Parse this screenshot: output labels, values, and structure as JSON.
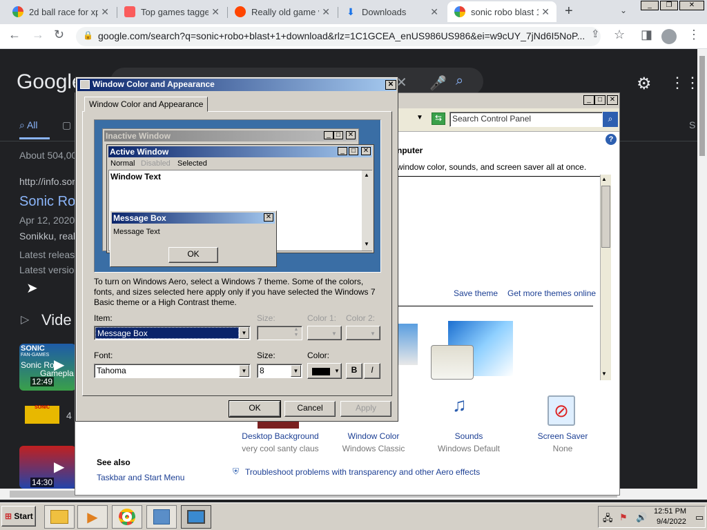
{
  "browser": {
    "tabs": [
      {
        "title": "2d ball race for xp",
        "fav": "google-icon"
      },
      {
        "title": "Top games tagged",
        "fav": "itch-icon"
      },
      {
        "title": "Really old game v",
        "fav": "reddit-icon"
      },
      {
        "title": "Downloads",
        "fav": "download-icon"
      },
      {
        "title": "sonic robo blast 1",
        "fav": "google-icon"
      }
    ],
    "url": "google.com/search?q=sonic+robo+blast+1+download&rlz=1C1GCEA_enUS986US986&ei=w9cUY_7jNd6I5NoP...",
    "new_tab": "+"
  },
  "google": {
    "logo": "Google",
    "tab_all": "All",
    "about": "About 504,00",
    "url_line": "http://info.son",
    "result_title": "Sonic Ro",
    "date_line": "Apr 12, 2020",
    "snippet1": "Sonikku, real",
    "snippet2": "Latest releas",
    "snippet3": "Latest versio",
    "videos_heading": "Vide",
    "video1_time": "12:49",
    "video1_line1": "SONIC",
    "video1_line2": "FAN-GAMES",
    "video1_title": "Sonic Ro",
    "video1_sub": "Gamepla",
    "video2_num": "4",
    "video2_label": "SONIC",
    "video3_time": "14:30",
    "right_clip": "S"
  },
  "control_panel": {
    "search_placeholder": "Search Control Panel",
    "heading": "nputer",
    "subtext": "window color, sounds, and screen saver all at once.",
    "save_theme": "Save theme",
    "get_more": "Get more themes online",
    "items": [
      {
        "label": "Desktop Background",
        "value": "very cool santy claus"
      },
      {
        "label": "Window Color",
        "value": "Windows Classic"
      },
      {
        "label": "Sounds",
        "value": "Windows Default"
      },
      {
        "label": "Screen Saver",
        "value": "None"
      }
    ],
    "see_also": "See also",
    "taskbar_link": "Taskbar and Start Menu",
    "troubleshoot": "Troubleshoot problems with transparency and other Aero effects"
  },
  "dialog": {
    "title": "Window Color and Appearance",
    "tab": "Window Color and Appearance",
    "preview": {
      "inactive": "Inactive Window",
      "active": "Active Window",
      "menu_normal": "Normal",
      "menu_disabled": "Disabled",
      "menu_selected": "Selected",
      "window_text": "Window Text",
      "msg_title": "Message Box",
      "msg_text": "Message Text",
      "msg_ok": "OK"
    },
    "info": "To turn on Windows Aero, select a Windows 7 theme.  Some of the colors, fonts, and sizes selected here apply only if you have selected the Windows 7 Basic theme or a High Contrast theme.",
    "item_label": "Item:",
    "item_value": "Message Box",
    "size_label": "Size:",
    "color1_label": "Color 1:",
    "color2_label": "Color 2:",
    "font_label": "Font:",
    "font_value": "Tahoma",
    "fsize_label": "Size:",
    "fsize_value": "8",
    "color_label": "Color:",
    "bold": "B",
    "italic": "I",
    "ok": "OK",
    "cancel": "Cancel",
    "apply": "Apply"
  },
  "taskbar": {
    "start": "Start",
    "time": "12:51 PM",
    "date": "9/4/2022"
  }
}
